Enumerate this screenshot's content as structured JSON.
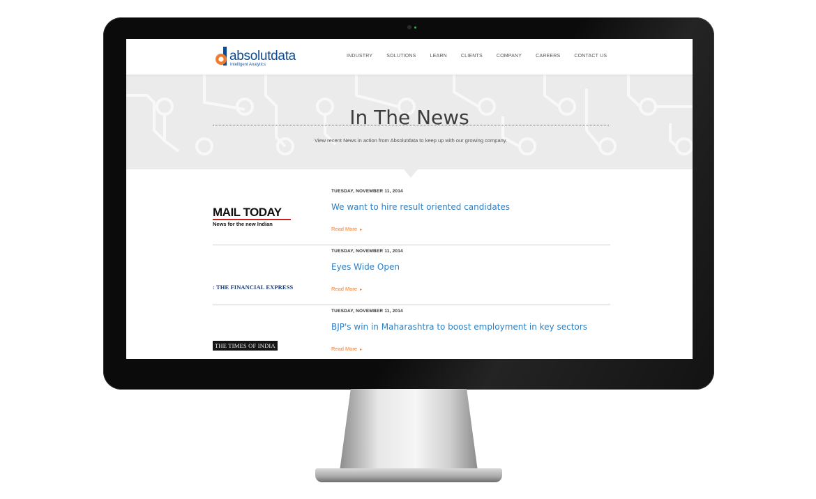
{
  "brand": {
    "name": "absolutdata",
    "tagline": "Intelligent Analytics",
    "colors": {
      "blue": "#0d4a8f",
      "orange": "#ef7b2e",
      "link": "#2e7fc3"
    }
  },
  "nav": {
    "items": [
      "INDUSTRY",
      "SOLUTIONS",
      "LEARN",
      "CLIENTS",
      "COMPANY",
      "CAREERS",
      "CONTACT US"
    ]
  },
  "hero": {
    "title": "In The News",
    "subtitle": "View recent News in action from Absolutdata to keep up with our growing company."
  },
  "news": [
    {
      "date": "TUESDAY, NOVEMBER 11, 2014",
      "title": "We want to hire result oriented candidates",
      "read_more": "Read More",
      "publication": {
        "name": "MAIL TODAY",
        "sub": "News for the new Indian"
      }
    },
    {
      "date": "TUESDAY, NOVEMBER 11, 2014",
      "title": "Eyes Wide Open",
      "read_more": "Read More",
      "publication": {
        "name": "THE FINANCIAL EXPRESS"
      }
    },
    {
      "date": "TUESDAY, NOVEMBER 11, 2014",
      "title": "BJP's win in Maharashtra to boost employment in key sectors",
      "read_more": "Read More",
      "publication": {
        "name": "THE TIMES OF INDIA"
      }
    }
  ]
}
